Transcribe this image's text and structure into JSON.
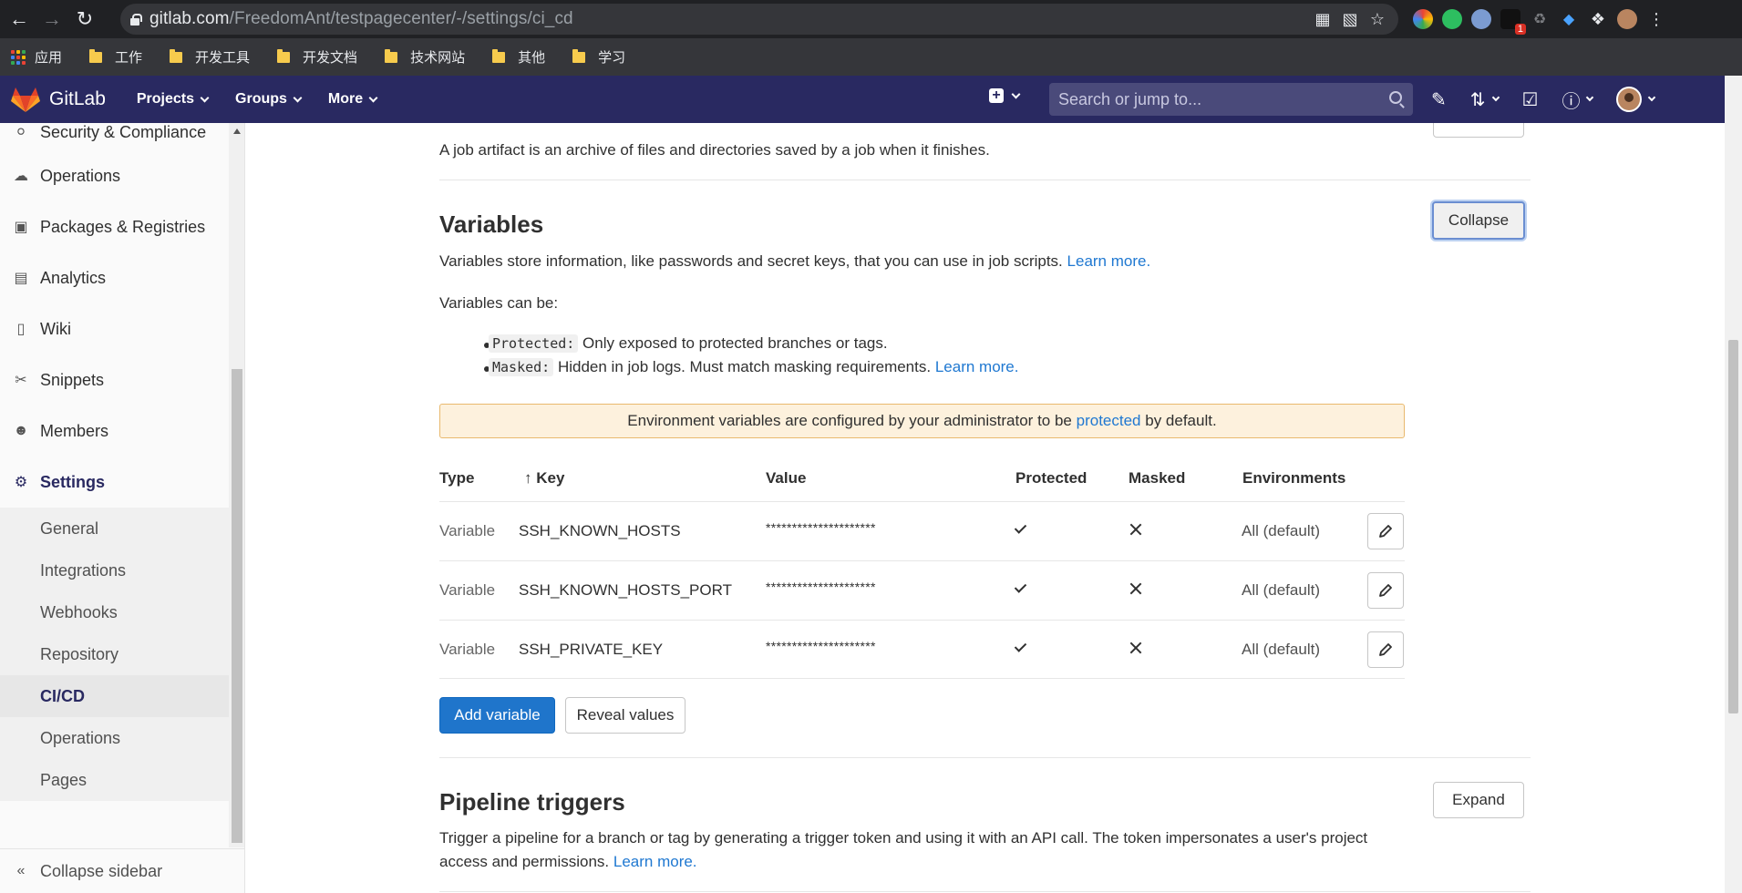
{
  "browser": {
    "url_host": "gitlab.com",
    "url_path": "/FreedomAnt/testpagecenter/-/settings/ci_cd",
    "ext_badge": "1",
    "bookmarks": [
      {
        "label": "应用",
        "type": "apps"
      },
      {
        "label": "工作",
        "type": "folder"
      },
      {
        "label": "开发工具",
        "type": "folder"
      },
      {
        "label": "开发文档",
        "type": "folder"
      },
      {
        "label": "技术网站",
        "type": "folder"
      },
      {
        "label": "其他",
        "type": "folder"
      },
      {
        "label": "学习",
        "type": "folder"
      }
    ]
  },
  "header": {
    "brand": "GitLab",
    "nav": [
      "Projects",
      "Groups",
      "More"
    ],
    "search_placeholder": "Search or jump to...",
    "color": "#292961"
  },
  "sidebar": {
    "items": [
      {
        "label": "Security & Compliance",
        "icon": "shield-icon"
      },
      {
        "label": "Operations",
        "icon": "cloud-gear-icon"
      },
      {
        "label": "Packages & Registries",
        "icon": "package-icon"
      },
      {
        "label": "Analytics",
        "icon": "chart-icon"
      },
      {
        "label": "Wiki",
        "icon": "book-icon"
      },
      {
        "label": "Snippets",
        "icon": "scissors-icon"
      },
      {
        "label": "Members",
        "icon": "users-icon"
      },
      {
        "label": "Settings",
        "icon": "gear-icon"
      }
    ],
    "subitems": [
      "General",
      "Integrations",
      "Webhooks",
      "Repository",
      "CI/CD",
      "Operations",
      "Pages"
    ],
    "active_subitem": "CI/CD",
    "collapse_label": "Collapse sidebar"
  },
  "main": {
    "artifacts_text": "A job artifact is an archive of files and directories saved by a job when it finishes.",
    "variables": {
      "title": "Variables",
      "collapse_label": "Collapse",
      "desc": "Variables store information, like passwords and secret keys, that you can use in job scripts.",
      "learn_more": "Learn more.",
      "can_be": "Variables can be:",
      "bullets": [
        {
          "code": "Protected:",
          "text": "Only exposed to protected branches or tags.",
          "link": ""
        },
        {
          "code": "Masked:",
          "text": "Hidden in job logs. Must match masking requirements.",
          "link": "Learn more."
        }
      ],
      "alert_before": "Environment variables are configured by your administrator to be",
      "alert_link": "protected",
      "alert_after": "by default.",
      "columns": {
        "type": "Type",
        "key": "Key",
        "value": "Value",
        "protected": "Protected",
        "masked": "Masked",
        "environments": "Environments"
      },
      "rows": [
        {
          "type": "Variable",
          "key": "SSH_KNOWN_HOSTS",
          "value": "*********************",
          "protected": true,
          "masked": false,
          "env": "All (default)"
        },
        {
          "type": "Variable",
          "key": "SSH_KNOWN_HOSTS_PORT",
          "value": "*********************",
          "protected": true,
          "masked": false,
          "env": "All (default)"
        },
        {
          "type": "Variable",
          "key": "SSH_PRIVATE_KEY",
          "value": "*********************",
          "protected": true,
          "masked": false,
          "env": "All (default)"
        }
      ],
      "add_label": "Add variable",
      "reveal_label": "Reveal values"
    },
    "triggers": {
      "title": "Pipeline triggers",
      "expand_label": "Expand",
      "desc_line1": "Trigger a pipeline for a branch or tag by generating a trigger token and using it with an API call. The token impersonates a user's project",
      "desc_line2": "access and permissions.",
      "learn_more": "Learn more."
    }
  }
}
